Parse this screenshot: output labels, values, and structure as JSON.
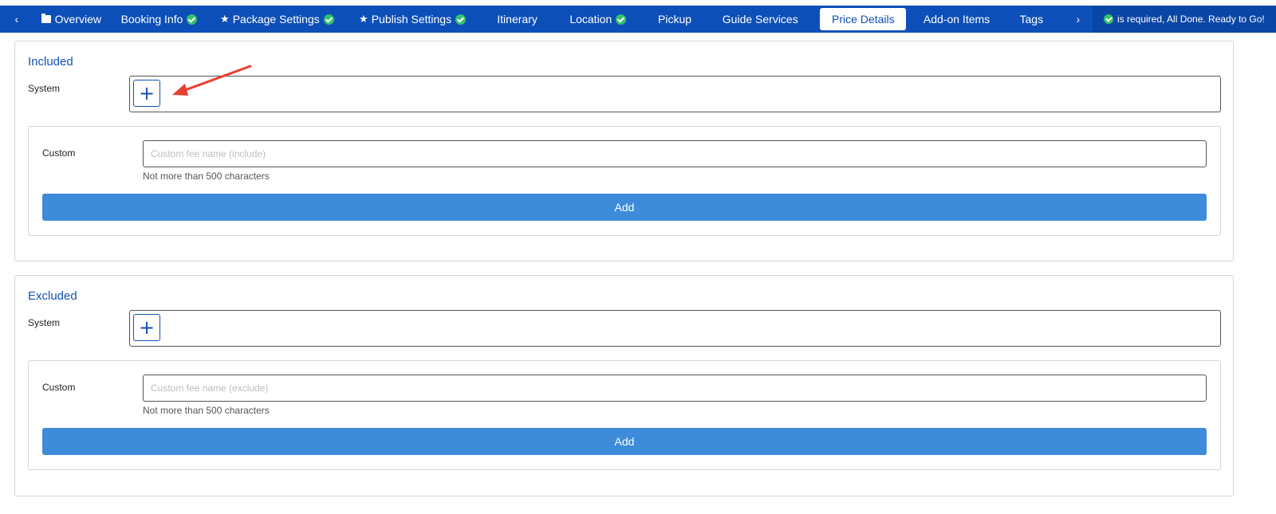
{
  "nav": {
    "prev_arrow": "‹",
    "next_arrow": "›",
    "tabs": [
      {
        "label": "Overview"
      },
      {
        "label": "Booking Info"
      },
      {
        "label": "Package Settings"
      },
      {
        "label": "Publish Settings"
      },
      {
        "label": "Itinerary"
      },
      {
        "label": "Location"
      },
      {
        "label": "Pickup"
      },
      {
        "label": "Guide Services"
      },
      {
        "label": "Price Details"
      },
      {
        "label": "Add-on Items"
      },
      {
        "label": "Tags"
      }
    ],
    "active_tab": "Price Details",
    "status_text": "is required,  All Done. Ready to Go!",
    "colors": {
      "bar": "#0d4fb8",
      "check": "#34c26b"
    }
  },
  "included": {
    "title": "Included",
    "system_label": "System",
    "custom_label": "Custom",
    "custom_placeholder": "Custom fee name (include)",
    "hint": "Not more than 500 characters",
    "add_label": "Add"
  },
  "excluded": {
    "title": "Excluded",
    "system_label": "System",
    "custom_label": "Custom",
    "custom_placeholder": "Custom fee name (exclude)",
    "hint": "Not more than 500 characters",
    "add_label": "Add"
  },
  "icons": {
    "plus": "plus-icon",
    "check": "check-circle-icon",
    "star": "star-icon",
    "folder": "folder-icon"
  }
}
